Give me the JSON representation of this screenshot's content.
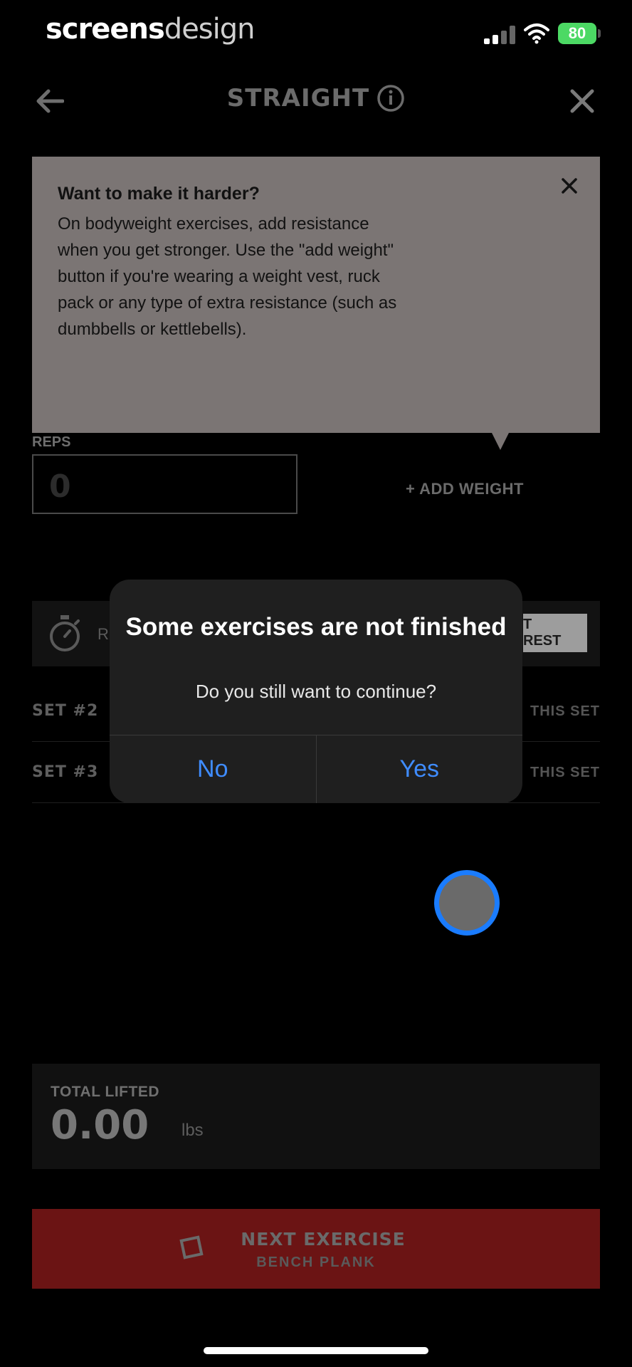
{
  "status_bar": {
    "brand_left": "screens",
    "brand_right": "design",
    "battery": "80"
  },
  "nav": {
    "title": "STRAIGHT"
  },
  "tip": {
    "title": "Want to make it harder?",
    "body": "On bodyweight exercises, add resistance when you get stronger. Use the \"add weight\" button if you're wearing a weight vest, ruck pack or any type of extra resistance (such as dumbbells or kettlebells)."
  },
  "reps": {
    "label": "REPS",
    "value": "0"
  },
  "add_weight_label": "+ ADD WEIGHT",
  "rest": {
    "label": "R",
    "button": "T REST"
  },
  "sets": [
    {
      "name": "SET #2",
      "action": "THIS SET"
    },
    {
      "name": "SET #3",
      "action": "THIS SET"
    }
  ],
  "total": {
    "label": "TOTAL LIFTED",
    "value": "0.00",
    "unit": "lbs"
  },
  "next": {
    "title": "NEXT EXERCISE",
    "subtitle": "BENCH PLANK"
  },
  "alert": {
    "title": "Some exercises are not finished",
    "message": "Do you still want to continue?",
    "no": "No",
    "yes": "Yes"
  },
  "colors": {
    "accent_blue": "#3f8cff",
    "next_button": "#6b1414",
    "battery": "#4cd964"
  }
}
